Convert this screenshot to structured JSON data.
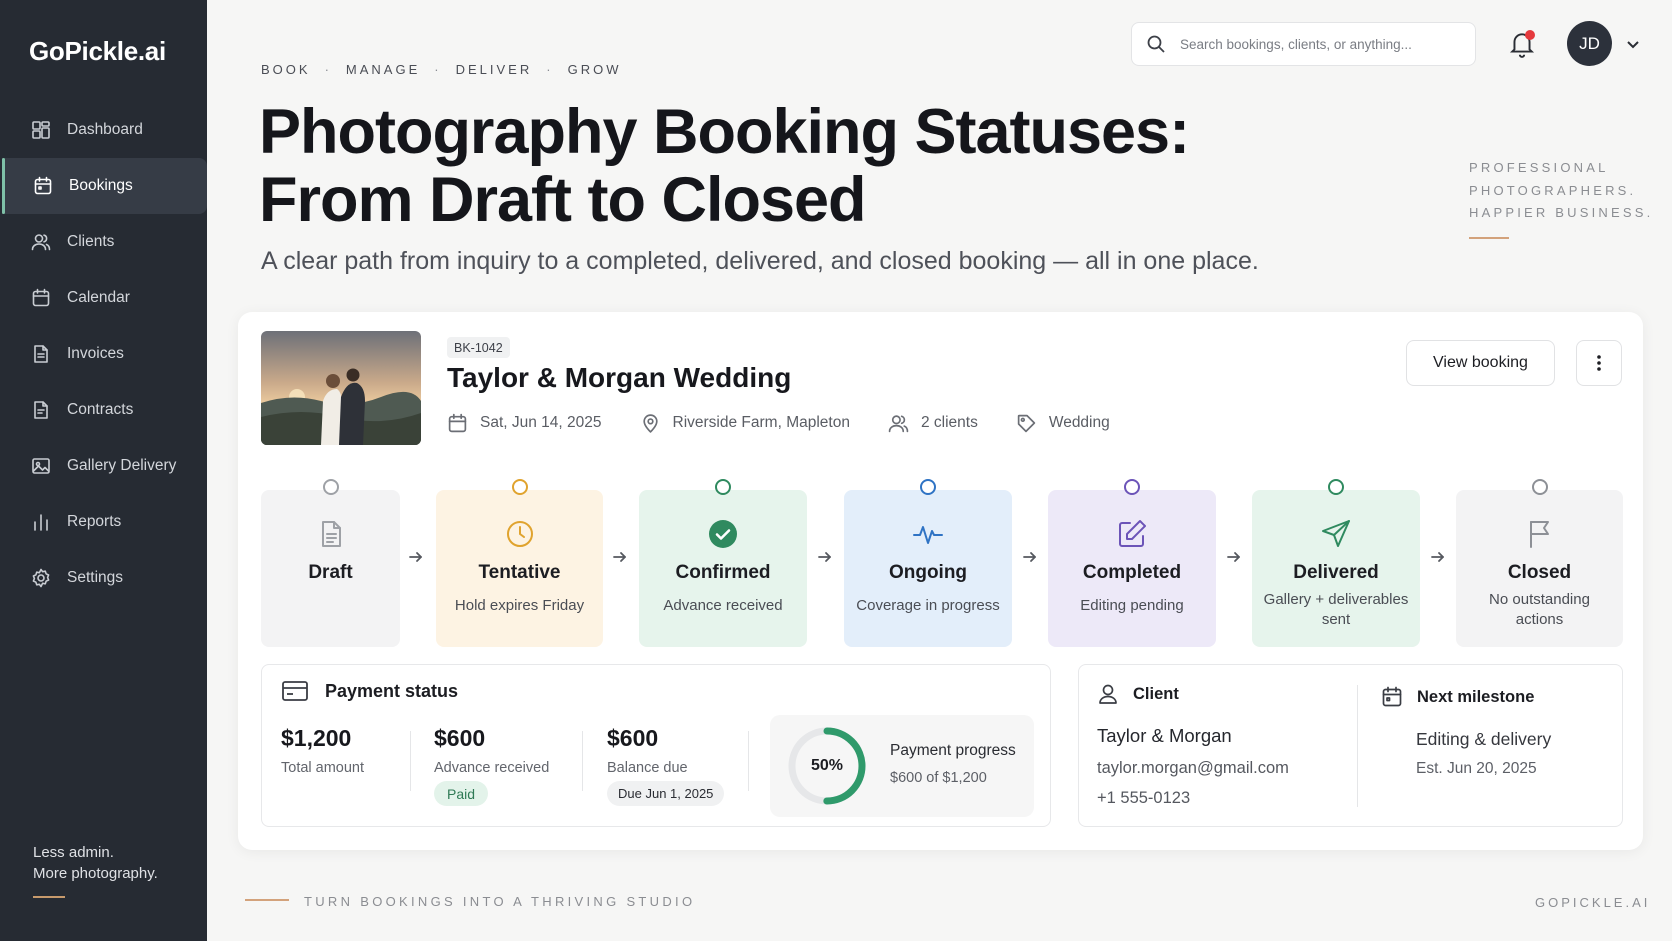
{
  "app": {
    "logo": "GoPickle.ai"
  },
  "sidebar": {
    "items": [
      {
        "label": "Dashboard",
        "icon": "dashboard-icon",
        "active": false
      },
      {
        "label": "Bookings",
        "icon": "calendar-icon",
        "active": true
      },
      {
        "label": "Clients",
        "icon": "users-icon",
        "active": false
      },
      {
        "label": "Calendar",
        "icon": "calendar-icon",
        "active": false
      },
      {
        "label": "Invoices",
        "icon": "document-icon",
        "active": false
      },
      {
        "label": "Contracts",
        "icon": "document-icon",
        "active": false
      },
      {
        "label": "Gallery Delivery",
        "icon": "image-icon",
        "active": false
      },
      {
        "label": "Reports",
        "icon": "bar-chart-icon",
        "active": false
      },
      {
        "label": "Settings",
        "icon": "gear-icon",
        "active": false
      }
    ],
    "tagline": [
      "Less admin.",
      "More photography."
    ]
  },
  "topbar": {
    "search_placeholder": "Search bookings, clients, or anything...",
    "avatar_initials": "JD"
  },
  "hero": {
    "kicker": [
      "BOOK",
      "MANAGE",
      "DELIVER",
      "GROW"
    ],
    "title_lines": [
      "Photography Booking Statuses:",
      "From Draft to Closed"
    ],
    "subtitle": "A clear path from inquiry to a completed, delivered, and closed booking — all in one place.",
    "side_note": [
      "PROFESSIONAL",
      "PHOTOGRAPHERS.",
      "HAPPIER BUSINESS."
    ]
  },
  "booking": {
    "id": "BK-1042",
    "title": "Taylor & Morgan Wedding",
    "date": "Sat, Jun 14, 2025",
    "location": "Riverside Farm, Mapleton",
    "clients": "2 clients",
    "tag": "Wedding",
    "view_button": "View booking"
  },
  "pipeline": [
    {
      "name": "Draft",
      "desc": "",
      "icon": "document-icon",
      "color": "#9ea1a6",
      "bg": "#f3f3f4"
    },
    {
      "name": "Tentative",
      "desc": "Hold expires Friday",
      "icon": "clock-icon",
      "color": "#e0a32e",
      "bg": "#fdf3e3"
    },
    {
      "name": "Confirmed",
      "desc": "Advance received",
      "icon": "check-circle-icon",
      "color": "#2f8a5f",
      "bg": "#e6f4ec"
    },
    {
      "name": "Ongoing",
      "desc": "Coverage in progress",
      "icon": "activity-icon",
      "color": "#2f73c4",
      "bg": "#e3eefa"
    },
    {
      "name": "Completed",
      "desc": "Editing pending",
      "icon": "edit-icon",
      "color": "#6c54b8",
      "bg": "#ede9f8"
    },
    {
      "name": "Delivered",
      "desc": "Gallery + deliverables sent",
      "icon": "send-icon",
      "color": "#2f8a5f",
      "bg": "#e6f4ec"
    },
    {
      "name": "Closed",
      "desc": "No outstanding actions",
      "icon": "flag-icon",
      "color": "#8d9096",
      "bg": "#f3f3f4"
    }
  ],
  "payment": {
    "heading": "Payment status",
    "total": {
      "value": "$1,200",
      "label": "Total amount"
    },
    "advance": {
      "value": "$600",
      "label": "Advance received",
      "badge": "Paid"
    },
    "balance": {
      "value": "$600",
      "label": "Balance due",
      "badge": "Due Jun 1, 2025"
    },
    "progress": {
      "percent_label": "50%",
      "fraction": 0.5,
      "label": "Payment progress",
      "sub": "$600 of $1,200"
    }
  },
  "client": {
    "heading": "Client",
    "name": "Taylor & Morgan",
    "email": "taylor.morgan@gmail.com",
    "phone": "+1 555-0123"
  },
  "milestone": {
    "heading": "Next milestone",
    "title": "Editing & delivery",
    "date": "Est. Jun 20, 2025"
  },
  "footer": {
    "left": "TURN BOOKINGS INTO A THRIVING STUDIO",
    "right": "GOPICKLE.AI"
  }
}
